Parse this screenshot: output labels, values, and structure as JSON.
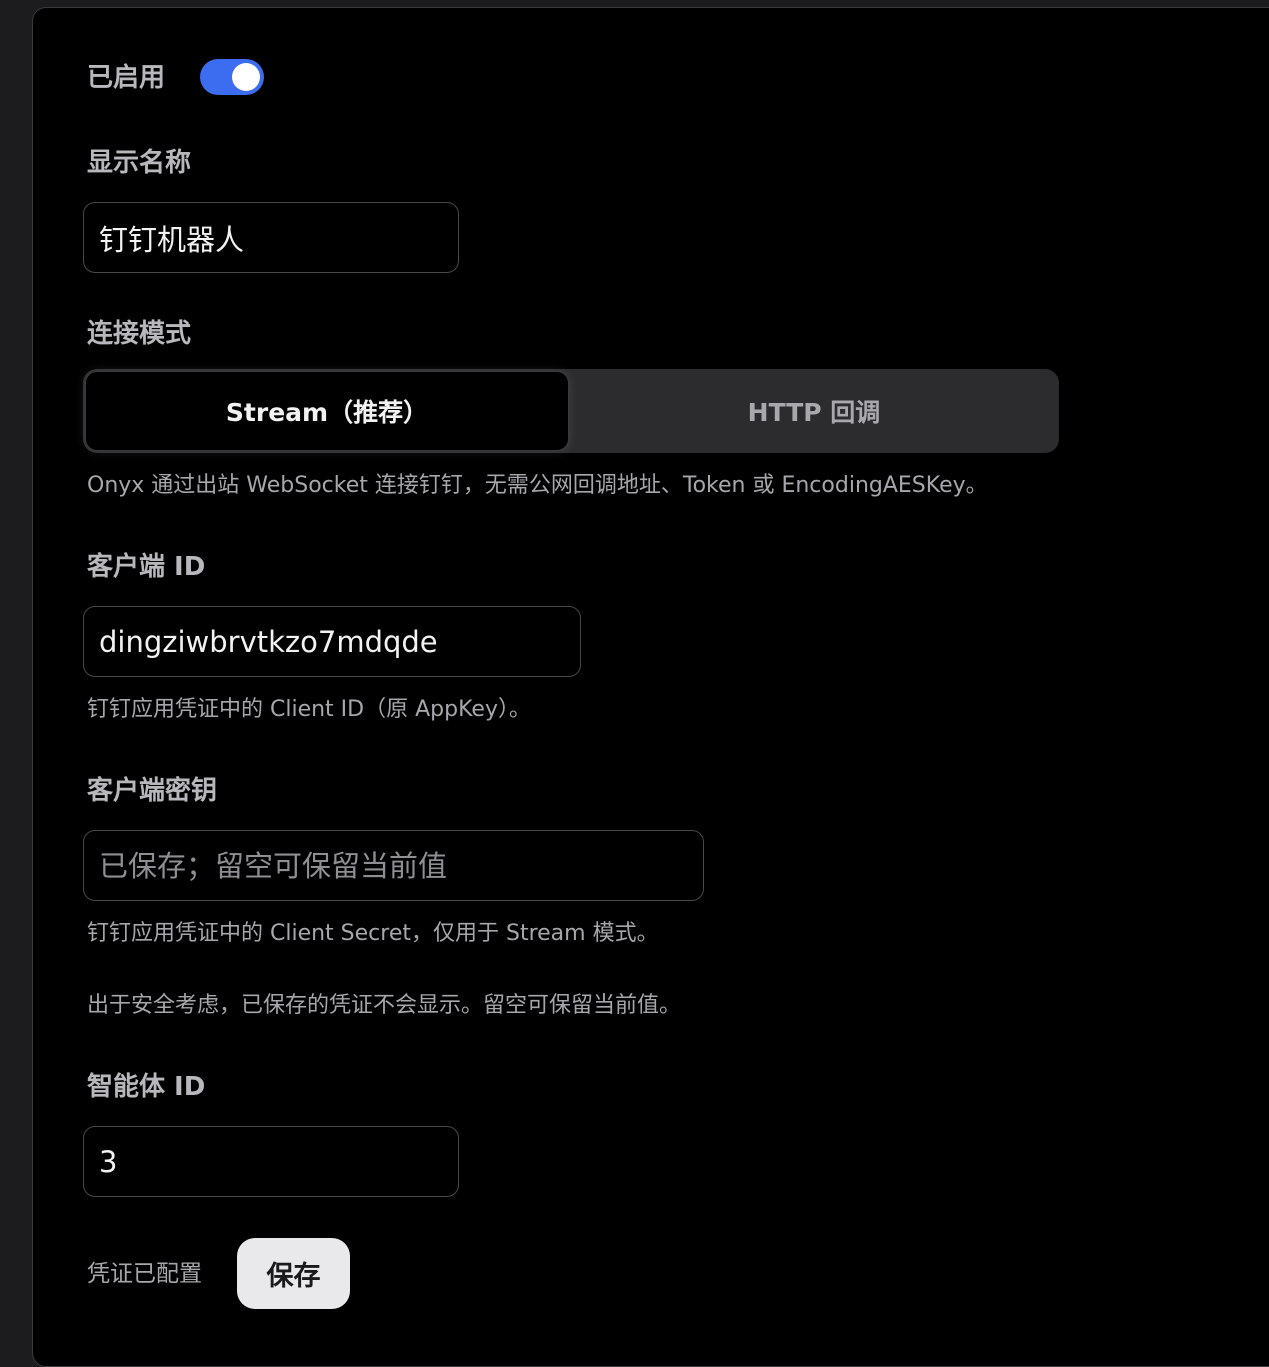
{
  "enabled": {
    "label": "已启用",
    "on": true,
    "accent": "#3c6cf0"
  },
  "display_name": {
    "label": "显示名称",
    "value": "钉钉机器人"
  },
  "connection_mode": {
    "label": "连接模式",
    "options": [
      "Stream（推荐）",
      "HTTP 回调"
    ],
    "selected": "Stream（推荐）",
    "help": "Onyx 通过出站 WebSocket 连接钉钉，无需公网回调地址、Token 或 EncodingAESKey。"
  },
  "client_id": {
    "label": "客户端 ID",
    "value": "dingziwbrvtkzo7mdqde",
    "help": "钉钉应用凭证中的 Client ID（原 AppKey）。"
  },
  "client_secret": {
    "label": "客户端密钥",
    "placeholder": "已保存；留空可保留当前值",
    "help": "钉钉应用凭证中的 Client Secret，仅用于 Stream 模式。",
    "note": "出于安全考虑，已保存的凭证不会显示。留空可保留当前值。"
  },
  "agent_id": {
    "label": "智能体 ID",
    "value": "3"
  },
  "footer": {
    "status": "凭证已配置",
    "save_label": "保存"
  }
}
